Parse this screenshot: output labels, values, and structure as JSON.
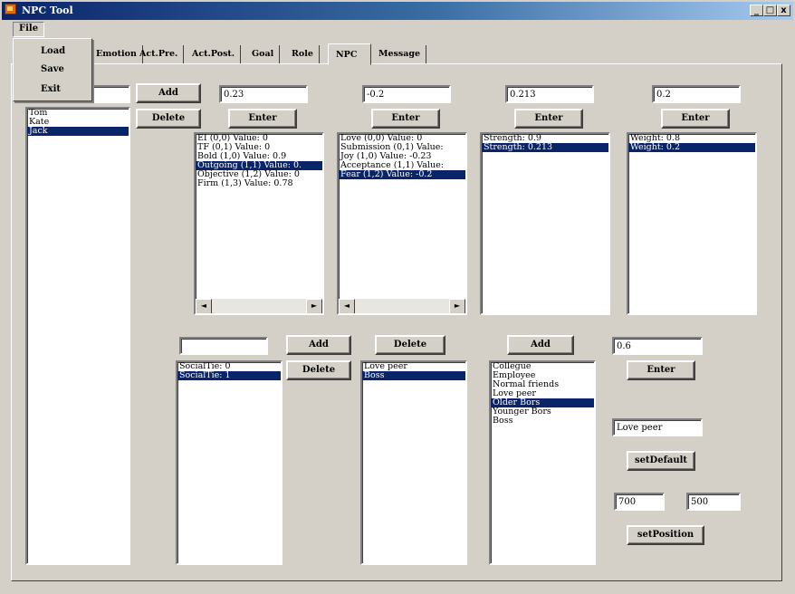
{
  "window": {
    "title": "NPC Tool",
    "minimize": "_",
    "restore": "□",
    "close": "x"
  },
  "menu": {
    "file": "File",
    "items": [
      "Load",
      "Save",
      "Exit"
    ]
  },
  "tabs": [
    "Emotion",
    "Act.Pre.",
    "Act.Post.",
    "Goal",
    "Role",
    "NPC",
    "Message"
  ],
  "active_tab": "NPC",
  "npc": {
    "name_value": "",
    "add_label": "Add",
    "delete_label": "Delete",
    "names": [
      "Tom",
      "Kate",
      "Jack"
    ],
    "selected": "Jack"
  },
  "personality": {
    "value": "0.23",
    "enter_label": "Enter",
    "items": [
      "EI (0,0) Value: 0",
      "TF (0,1) Value: 0",
      "Bold (1,0) Value: 0.9",
      "Outgoing (1,1) Value: 0.",
      "Objective (1,2) Value: 0",
      "Firm (1,3) Value: 0.78"
    ],
    "selected_index": 3
  },
  "emotion": {
    "value": "-0.2",
    "enter_label": "Enter",
    "items": [
      "Love (0,0) Value: 0",
      "Submission (0,1) Value:",
      "Joy (1,0) Value: -0.23",
      "Acceptance (1,1) Value:",
      "Fear (1,2) Value: -0.2"
    ],
    "selected_index": 4
  },
  "strength": {
    "value": "0.213",
    "enter_label": "Enter",
    "items": [
      "Strength: 0.9",
      "Strength: 0.213"
    ],
    "selected_index": 1
  },
  "weight": {
    "value": "0.2",
    "enter_label": "Enter",
    "items": [
      "Weight: 0.8",
      "Weight: 0.2"
    ],
    "selected_index": 1
  },
  "social": {
    "input_value": "",
    "add_label": "Add",
    "delete_label": "Delete",
    "items": [
      "SocialTie: 0",
      "SocialTie: 1"
    ],
    "selected_index": 1
  },
  "ties": {
    "delete_label": "Delete",
    "items": [
      "Love peer",
      "Boss"
    ],
    "selected_index": 1
  },
  "relations": {
    "add_label": "Add",
    "items": [
      "Collegue",
      "Employee",
      "Normal friends",
      "Love peer",
      "Older Bors",
      "Younger Bors",
      "Boss"
    ],
    "selected_index": 4
  },
  "right_panel": {
    "value": "0.6",
    "enter_label": "Enter",
    "relation_value": "Love peer",
    "set_default_label": "setDefault",
    "pos_x": "700",
    "pos_y": "500",
    "set_position_label": "setPosition"
  },
  "scroll": {
    "left": "◄",
    "right": "►"
  }
}
